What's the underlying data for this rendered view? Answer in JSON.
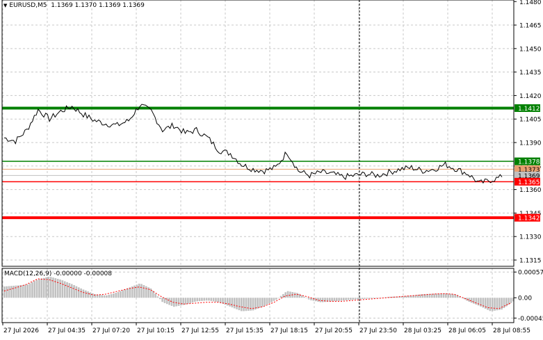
{
  "header": {
    "symbol_timeframe": "EURUSD,M5",
    "ohlc": "1.1369 1.1370 1.1369 1.1369"
  },
  "macd": {
    "label": "MACD(12,26,9) -0.00000 -0.00008",
    "ticks": [
      "0.00057",
      "0.00",
      "-0.00045"
    ],
    "tick_values": [
      0.00057,
      0.0,
      -0.00045
    ]
  },
  "colors": {
    "green": "#008000",
    "red": "#ff0000",
    "price_line": "#000000",
    "bid_line": "#c0c0c0",
    "ask_line": "#e8a070",
    "grid": "#c8c8c8",
    "histogram": "#c0c0c0",
    "signal": "#ff0000"
  },
  "chart_data": {
    "type": "line",
    "title": "EURUSD,M5",
    "x_ticks": [
      "27 Jul 2026",
      "27 Jul 04:35",
      "27 Jul 07:20",
      "27 Jul 10:15",
      "27 Jul 12:55",
      "27 Jul 15:35",
      "27 Jul 18:15",
      "27 Jul 20:55",
      "27 Jul 23:50",
      "28 Jul 03:25",
      "28 Jul 06:05",
      "28 Jul 08:55"
    ],
    "y_ticks": [
      "1.1480",
      "1.1465",
      "1.1450",
      "1.1435",
      "1.1420",
      "1.1405",
      "1.1390",
      "1.1375",
      "1.1360",
      "1.1345",
      "1.1330",
      "1.1315"
    ],
    "ylim": [
      1.1311,
      1.1481
    ],
    "price_series": [
      1.1393,
      1.1391,
      1.1398,
      1.1411,
      1.1405,
      1.141,
      1.1413,
      1.1408,
      1.1404,
      1.1402,
      1.1401,
      1.1404,
      1.1414,
      1.141,
      1.1398,
      1.1401,
      1.1396,
      1.1398,
      1.1393,
      1.1385,
      1.1383,
      1.1376,
      1.1373,
      1.1372,
      1.1374,
      1.1384,
      1.1372,
      1.1369,
      1.1371,
      1.137,
      1.1368,
      1.1369,
      1.137,
      1.1369,
      1.1371,
      1.1373,
      1.1374,
      1.1372,
      1.1373,
      1.1376,
      1.1373,
      1.137,
      1.1364,
      1.1366,
      1.1368
    ],
    "levels": [
      {
        "label": "1.1412",
        "value": 1.1412,
        "color": "green",
        "thick": true
      },
      {
        "label": "1.1378",
        "value": 1.1378,
        "color": "green",
        "thick": false
      },
      {
        "label": "1.1373",
        "value": 1.1373,
        "color": "ask",
        "thick": false
      },
      {
        "label": "1.1369",
        "value": 1.1369,
        "color": "bid",
        "thick": false
      },
      {
        "label": "1.1365",
        "value": 1.1365,
        "color": "red",
        "thick": false
      },
      {
        "label": "1.1342",
        "value": 1.1342,
        "color": "red",
        "thick": true
      }
    ],
    "macd_histogram": [
      0.00025,
      0.00027,
      0.00029,
      0.00041,
      0.00047,
      0.0004,
      0.0003,
      0.00018,
      8e-05,
      5e-05,
      0.00012,
      0.00022,
      0.00032,
      0.0002,
      -0.0001,
      -0.0002,
      -0.00015,
      -8e-05,
      -6e-05,
      -0.0001,
      -0.0002,
      -0.0003,
      -0.00028,
      -0.00018,
      -5e-05,
      0.00015,
      0.0001,
      -5e-05,
      -0.0001,
      -8e-05,
      -6e-05,
      -4e-05,
      -2e-05,
      -1e-05,
      2e-05,
      3e-05,
      5e-05,
      8e-05,
      9e-05,
      0.0001,
      7e-05,
      -8e-05,
      -0.00018,
      -0.0003,
      -0.00026,
      -8e-05
    ],
    "macd_signal": [
      0.00015,
      0.00022,
      0.0003,
      0.00042,
      0.0004,
      0.00032,
      0.00022,
      0.00012,
      6e-05,
      8e-05,
      0.00014,
      0.0002,
      0.00024,
      0.00018,
      2e-05,
      -0.0001,
      -0.00014,
      -0.00012,
      -0.0001,
      -0.0001,
      -0.00014,
      -0.0002,
      -0.00024,
      -0.0002,
      -0.0001,
      4e-05,
      8e-05,
      2e-05,
      -6e-05,
      -8e-05,
      -8e-05,
      -6e-05,
      -4e-05,
      -2e-05,
      0.0,
      2e-05,
      4e-05,
      6e-05,
      8e-05,
      9e-05,
      8e-05,
      -2e-05,
      -0.00012,
      -0.00022,
      -0.00024,
      -0.00012
    ]
  }
}
